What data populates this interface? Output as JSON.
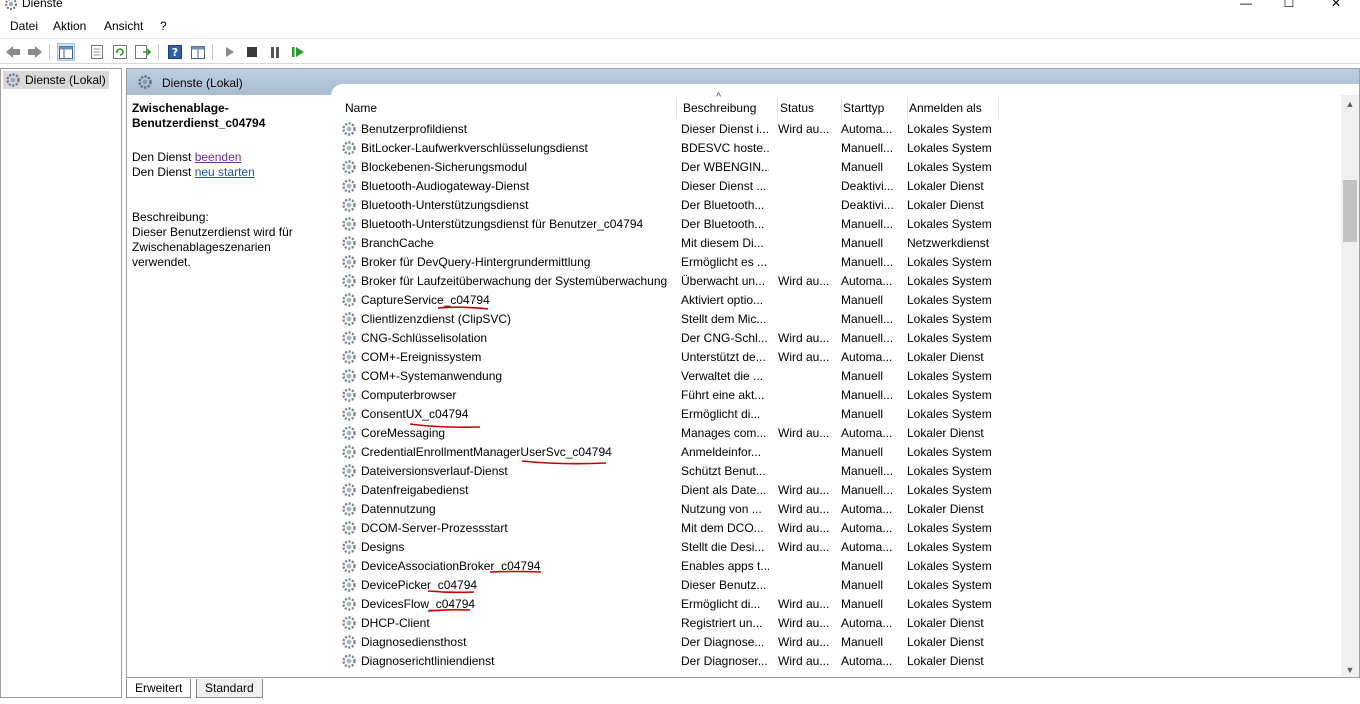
{
  "window": {
    "title": "Dienste",
    "min": "—",
    "max": "☐",
    "close": "✕"
  },
  "menu": [
    "Datei",
    "Aktion",
    "Ansicht",
    "?"
  ],
  "toolbar_icons": [
    "back-icon",
    "forward-icon",
    "show-tree-icon",
    "properties-icon",
    "refresh-icon",
    "export-icon",
    "help-icon",
    "view-icon",
    "start-icon",
    "stop-icon",
    "pause-icon",
    "resume-icon"
  ],
  "tree": {
    "root": "Dienste (Lokal)"
  },
  "panel": {
    "header": "Dienste (Lokal)",
    "selected_service": "Zwischenablage-Benutzerdienst_c04794",
    "selected_service_line1": "Zwischenablage-",
    "selected_service_line2": "Benutzerdienst_c04794",
    "action_prefix": "Den Dienst ",
    "stop_link": "beenden",
    "restart_link": "neu starten",
    "desc_label": "Beschreibung:",
    "desc_line1": "Dieser Benutzerdienst wird für",
    "desc_line2": "Zwischenablageszenarien verwendet."
  },
  "columns": [
    "Name",
    "Beschreibung",
    "Status",
    "Starttyp",
    "Anmelden als"
  ],
  "rows": [
    {
      "name": "Benutzerprofildienst",
      "desc": "Dieser Dienst i...",
      "status": "Wird au...",
      "start": "Automa...",
      "logon": "Lokales System"
    },
    {
      "name": "BitLocker-Laufwerkverschlüsselungsdienst",
      "desc": "BDESVC hoste...",
      "status": "",
      "start": "Manuell...",
      "logon": "Lokales System"
    },
    {
      "name": "Blockebenen-Sicherungsmodul",
      "desc": "Der WBENGIN...",
      "status": "",
      "start": "Manuell",
      "logon": "Lokales System"
    },
    {
      "name": "Bluetooth-Audiogateway-Dienst",
      "desc": "Dieser Dienst ...",
      "status": "",
      "start": "Deaktivi...",
      "logon": "Lokaler Dienst"
    },
    {
      "name": "Bluetooth-Unterstützungsdienst",
      "desc": "Der Bluetooth...",
      "status": "",
      "start": "Deaktivi...",
      "logon": "Lokaler Dienst"
    },
    {
      "name": "Bluetooth-Unterstützungsdienst für Benutzer_c04794",
      "desc": "Der Bluetooth...",
      "status": "",
      "start": "Manuell...",
      "logon": "Lokales System"
    },
    {
      "name": "BranchCache",
      "desc": "Mit diesem Di...",
      "status": "",
      "start": "Manuell",
      "logon": "Netzwerkdienst"
    },
    {
      "name": "Broker für DevQuery-Hintergrundermittlung",
      "desc": "Ermöglicht es ...",
      "status": "",
      "start": "Manuell...",
      "logon": "Lokales System"
    },
    {
      "name": "Broker für Laufzeitüberwachung der Systemüberwachung",
      "desc": "Überwacht un...",
      "status": "Wird au...",
      "start": "Automa...",
      "logon": "Lokales System"
    },
    {
      "name": "CaptureService_c04794",
      "desc": "Aktiviert optio...",
      "status": "",
      "start": "Manuell",
      "logon": "Lokales System"
    },
    {
      "name": "Clientlizenzdienst (ClipSVC)",
      "desc": "Stellt dem Mic...",
      "status": "",
      "start": "Manuell...",
      "logon": "Lokales System"
    },
    {
      "name": "CNG-Schlüsselisolation",
      "desc": "Der CNG-Schl...",
      "status": "Wird au...",
      "start": "Manuell...",
      "logon": "Lokales System"
    },
    {
      "name": "COM+-Ereignissystem",
      "desc": "Unterstützt de...",
      "status": "Wird au...",
      "start": "Automa...",
      "logon": "Lokaler Dienst"
    },
    {
      "name": "COM+-Systemanwendung",
      "desc": "Verwaltet die ...",
      "status": "",
      "start": "Manuell",
      "logon": "Lokales System"
    },
    {
      "name": "Computerbrowser",
      "desc": "Führt eine akt...",
      "status": "",
      "start": "Manuell...",
      "logon": "Lokales System"
    },
    {
      "name": "ConsentUX_c04794",
      "desc": "Ermöglicht di...",
      "status": "",
      "start": "Manuell",
      "logon": "Lokales System"
    },
    {
      "name": "CoreMessaging",
      "desc": "Manages com...",
      "status": "Wird au...",
      "start": "Automa...",
      "logon": "Lokaler Dienst"
    },
    {
      "name": "CredentialEnrollmentManagerUserSvc_c04794",
      "desc": "Anmeldeinfor...",
      "status": "",
      "start": "Manuell",
      "logon": "Lokales System"
    },
    {
      "name": "Dateiversionsverlauf-Dienst",
      "desc": "Schützt Benut...",
      "status": "",
      "start": "Manuell...",
      "logon": "Lokales System"
    },
    {
      "name": "Datenfreigabedienst",
      "desc": "Dient als Date...",
      "status": "Wird au...",
      "start": "Manuell...",
      "logon": "Lokales System"
    },
    {
      "name": "Datennutzung",
      "desc": "Nutzung von ...",
      "status": "Wird au...",
      "start": "Automa...",
      "logon": "Lokaler Dienst"
    },
    {
      "name": "DCOM-Server-Prozessstart",
      "desc": "Mit dem DCO...",
      "status": "Wird au...",
      "start": "Automa...",
      "logon": "Lokales System"
    },
    {
      "name": "Designs",
      "desc": "Stellt die Desi...",
      "status": "Wird au...",
      "start": "Automa...",
      "logon": "Lokales System"
    },
    {
      "name": "DeviceAssociationBroker_c04794",
      "desc": "Enables apps t...",
      "status": "",
      "start": "Manuell",
      "logon": "Lokales System"
    },
    {
      "name": "DevicePicker_c04794",
      "desc": "Dieser Benutz...",
      "status": "",
      "start": "Manuell",
      "logon": "Lokales System"
    },
    {
      "name": "DevicesFlow_c04794",
      "desc": "Ermöglicht di...",
      "status": "Wird au...",
      "start": "Manuell",
      "logon": "Lokales System"
    },
    {
      "name": "DHCP-Client",
      "desc": "Registriert un...",
      "status": "Wird au...",
      "start": "Automa...",
      "logon": "Lokaler Dienst"
    },
    {
      "name": "Diagnosediensthost",
      "desc": "Der Diagnose...",
      "status": "Wird au...",
      "start": "Manuell",
      "logon": "Lokaler Dienst"
    },
    {
      "name": "Diagnosericht­liniendienst",
      "desc": "Der Diagnoser...",
      "status": "Wird au...",
      "start": "Automa...",
      "logon": "Lokaler Dienst"
    }
  ],
  "tabs": [
    "Erweitert",
    "Standard"
  ],
  "annotation_color": "#cc0000"
}
